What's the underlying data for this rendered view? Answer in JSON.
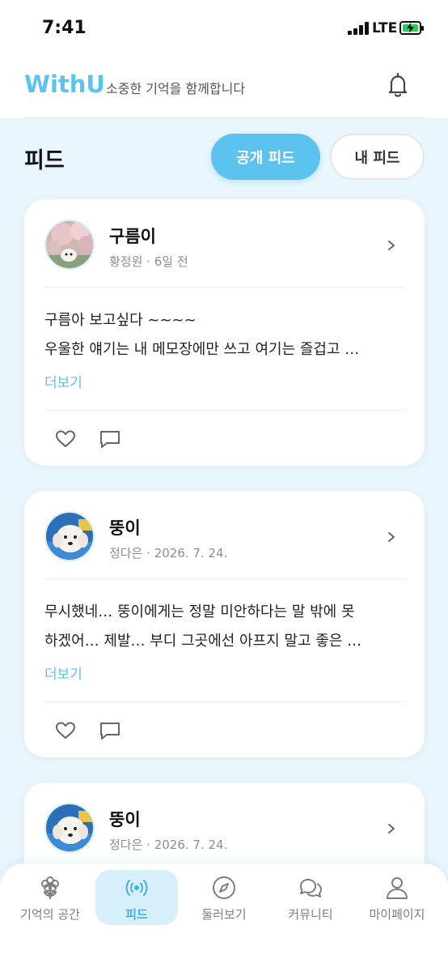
{
  "status_bar": {
    "time": "7:41",
    "network": "LTE"
  },
  "header": {
    "logo": "WithU",
    "tagline": "소중한 기억을 함께합니다"
  },
  "feed": {
    "title": "피드",
    "tabs": {
      "public": "공개 피드",
      "mine": "내 피드"
    }
  },
  "posts": [
    {
      "name": "구름이",
      "meta": "황정원 · 6일 전",
      "lines": [
        "구름아 보고싶다 ~~~~",
        "우울한 얘기는 내 메모장에만 쓰고 여기는 즐겁고 …"
      ],
      "more": "더보기"
    },
    {
      "name": "뚱이",
      "meta": "정다은 · 2026. 7. 24.",
      "lines": [
        "무시했네… 뚱이에게는 정말 미안하다는 말 밖에 못",
        "하겠어… 제발… 부디 그곳에선 아프지 말고 좋은 …"
      ],
      "more": "더보기"
    },
    {
      "name": "뚱이",
      "meta": "정다은 · 2026. 7. 24."
    }
  ],
  "tabbar": {
    "items": [
      {
        "label": "기억의 공간",
        "icon": "flower-icon"
      },
      {
        "label": "피드",
        "icon": "broadcast-icon",
        "active": true
      },
      {
        "label": "둘러보기",
        "icon": "compass-icon"
      },
      {
        "label": "커뮤니티",
        "icon": "chat-bubbles-icon"
      },
      {
        "label": "마이페이지",
        "icon": "person-icon"
      }
    ]
  },
  "colors": {
    "accent": "#5cc3ee",
    "background": "#eaf6fd",
    "battery": "#34c759"
  }
}
